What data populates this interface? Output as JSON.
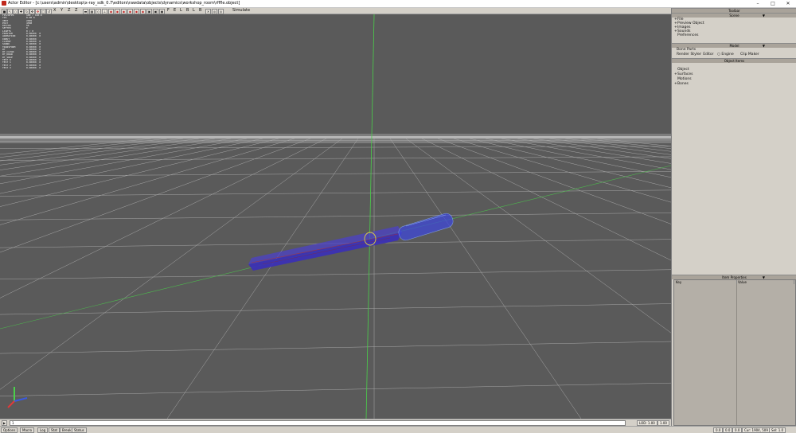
{
  "window": {
    "title": "Actor Editor - [c:\\users\\admin\\desktop\\x-ray_sdk_0.7\\editors\\rawdata\\objects\\dynamics\\workshop_room\\rfffle.object]",
    "minimize": "–",
    "maximize": "□",
    "close": "✕"
  },
  "toolbar": {
    "axis_x": "X",
    "axis_y": "Y",
    "axis_z": "Z",
    "axis_zz": "Z",
    "snap_labels": [
      "F",
      "E",
      "L",
      "B",
      "L",
      "B"
    ],
    "simulate": "Simulate"
  },
  "stats": [
    {
      "k": "FPS/RFPS",
      "v": "100 / 100.0"
    },
    {
      "k": "TPS",
      "v": "0.00 K"
    },
    {
      "k": "VERT",
      "v": "2689"
    },
    {
      "k": "POLY",
      "v": "4588"
    },
    {
      "k": "DIP/RS",
      "v": "56"
    },
    {
      "k": "SETTEX",
      "v": "0"
    },
    {
      "k": "LIGHTS",
      "v": "0 / 0"
    },
    {
      "k": "FRUSTUM",
      "v": "0.00000  0"
    },
    {
      "k": "ANIMATION",
      "v": "0.00000  0"
    },
    {
      "k": "",
      "v": ""
    },
    {
      "k": "INPUT",
      "v": "0.00000"
    },
    {
      "k": "CLIENT",
      "v": "0.00000  0"
    },
    {
      "k": "SOUND",
      "v": "0.00000  0"
    },
    {
      "k": "TRANSFORM",
      "v": "0.00000  0"
    },
    {
      "k": "",
      "v": ""
    },
    {
      "k": "RT",
      "v": "0.00000  0"
    },
    {
      "k": "RT_CLEAR",
      "v": "0.00000  0"
    },
    {
      "k": "RT_DRAW",
      "v": "0.00000  0"
    },
    {
      "k": "RT_SWAP",
      "v": "0.00000  0"
    },
    {
      "k": "",
      "v": ""
    },
    {
      "k": "TEST 0",
      "v": "0.00000  0"
    },
    {
      "k": "TEST 1",
      "v": "0.00000  0"
    },
    {
      "k": "TEST 2",
      "v": "0.00000  0"
    },
    {
      "k": "TEST 3",
      "v": "0.00000  0"
    }
  ],
  "command": {
    "value": "1"
  },
  "statusbar": {
    "tabs": [
      "Options",
      "Macro",
      "Log",
      "Stat",
      "Break",
      "Status"
    ],
    "lod": "LOD: 1.00",
    "zoom": "1.00",
    "coords": [
      "0.0",
      "0.0",
      "0.0"
    ],
    "cursor": "Cur: 1904, 509",
    "grid": "Sel: 1.0"
  },
  "panel": {
    "toolbar_header": "Toolbar",
    "scene_header": "Scene",
    "scene_items": [
      {
        "prefix": "+",
        "label": "File"
      },
      {
        "prefix": "+",
        "label": "Preview Object"
      },
      {
        "prefix": "+",
        "label": "Images"
      },
      {
        "prefix": "+",
        "label": "Sounds"
      },
      {
        "prefix": "",
        "label": "Preferences"
      }
    ],
    "model_header": "Model",
    "bone_parts": "Bone Parts",
    "render_style_label": "Render Style:",
    "render_editor": "Editor",
    "render_engine": "Engine",
    "clip_maker": "Clip Maker",
    "object_items_header": "Object Items",
    "object_items": [
      {
        "prefix": "",
        "label": "Object"
      },
      {
        "prefix": "+",
        "label": "Surfaces"
      },
      {
        "prefix": "",
        "label": "Motions"
      },
      {
        "prefix": "+",
        "label": "Bones"
      }
    ],
    "item_properties_header": "Item Properties",
    "prop_col_key": "Key",
    "prop_col_value": "Value"
  },
  "colors": {
    "viewport": "#5a5a5a",
    "grid": "#9a9a9a",
    "axis_green": "#4ad04a",
    "axis_x": "#e03a3a",
    "axis_z": "#3a5ae0",
    "object_blue": "#3a2fb8",
    "selection": "#e0d23a"
  }
}
